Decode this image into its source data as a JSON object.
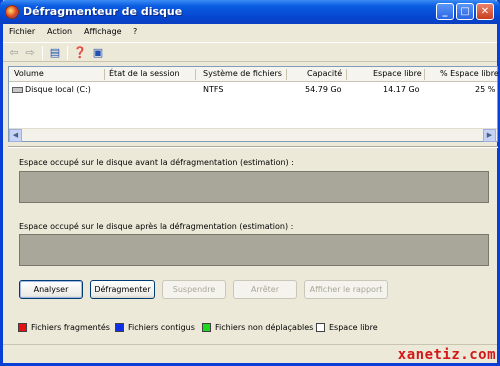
{
  "window": {
    "title": "Défragmenteur de disque"
  },
  "menu": {
    "items": [
      "Fichier",
      "Action",
      "Affichage",
      "?"
    ]
  },
  "volumes": {
    "columns": [
      "Volume",
      "État de la session",
      "Système de fichiers",
      "Capacité",
      "Espace libre",
      "% Espace libre"
    ],
    "rows": [
      {
        "volume": "Disque local (C:)",
        "state": "",
        "fs": "NTFS",
        "capacity": "54.79 Go",
        "free": "14.17 Go",
        "free_pct": "25 %"
      }
    ]
  },
  "analysis": {
    "before_label": "Espace occupé sur le disque avant la défragmentation (estimation) :",
    "after_label": "Espace occupé sur le disque après la défragmentation (estimation) :"
  },
  "buttons": {
    "analyze": "Analyser",
    "defragment": "Défragmenter",
    "pause": "Suspendre",
    "stop": "Arrêter",
    "report": "Afficher le rapport"
  },
  "legend": {
    "items": [
      {
        "label": "Fichiers fragmentés",
        "color": "#e81010"
      },
      {
        "label": "Fichiers contigus",
        "color": "#1030e8"
      },
      {
        "label": "Fichiers non déplaçables",
        "color": "#20d820"
      },
      {
        "label": "Espace libre",
        "color": "#ffffff"
      }
    ]
  },
  "watermark": "xanetiz.com"
}
